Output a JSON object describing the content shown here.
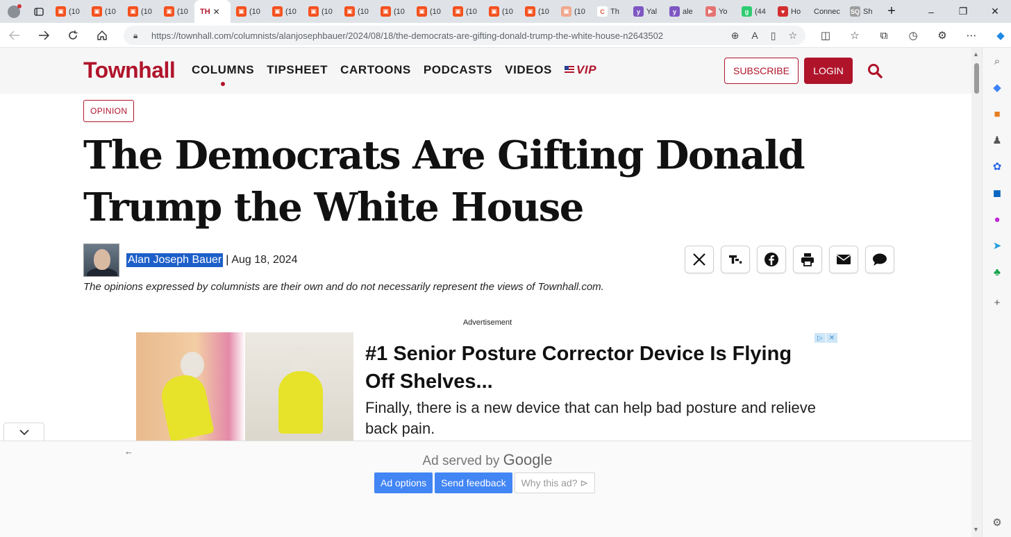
{
  "browser": {
    "tabs": [
      {
        "label": "(10",
        "fav": "#f4511e",
        "glyph": "▣"
      },
      {
        "label": "(10",
        "fav": "#f4511e",
        "glyph": "▣"
      },
      {
        "label": "(10",
        "fav": "#f4511e",
        "glyph": "▣"
      },
      {
        "label": "(10",
        "fav": "#f4511e",
        "glyph": "▣"
      },
      {
        "label": "TH",
        "fav": "",
        "glyph": "",
        "active": true
      },
      {
        "label": "(10",
        "fav": "#f4511e",
        "glyph": "▣"
      },
      {
        "label": "(10",
        "fav": "#f4511e",
        "glyph": "▣"
      },
      {
        "label": "(10",
        "fav": "#f4511e",
        "glyph": "▣"
      },
      {
        "label": "(10",
        "fav": "#f4511e",
        "glyph": "▣"
      },
      {
        "label": "(10",
        "fav": "#f4511e",
        "glyph": "▣"
      },
      {
        "label": "(10",
        "fav": "#f4511e",
        "glyph": "▣"
      },
      {
        "label": "(10",
        "fav": "#f4511e",
        "glyph": "▣"
      },
      {
        "label": "(10",
        "fav": "#f4511e",
        "glyph": "▣"
      },
      {
        "label": "(10",
        "fav": "#f4511e",
        "glyph": "▣"
      },
      {
        "label": "(10",
        "fav": "#f0a88e",
        "glyph": "▣"
      },
      {
        "label": "Th",
        "fav": "#ffffff",
        "glyph": "C"
      },
      {
        "label": "Yal",
        "fav": "#7e57c2",
        "glyph": "y"
      },
      {
        "label": "ale",
        "fav": "#7e57c2",
        "glyph": "y"
      },
      {
        "label": "Yo",
        "fav": "#e57373",
        "glyph": "▶"
      },
      {
        "label": "(44",
        "fav": "#2ecc71",
        "glyph": "g"
      },
      {
        "label": "Ho",
        "fav": "#d32f2f",
        "glyph": "♥"
      },
      {
        "label": "Connec",
        "fav": "",
        "glyph": ""
      },
      {
        "label": "Sh",
        "fav": "#9e9e9e",
        "glyph": "SQ"
      }
    ],
    "url_host": "https://townhall.com",
    "url_path": "/columnists/alanjosephbauer/2024/08/18/the-democrats-are-gifting-donald-trump-the-white-house-n2643502"
  },
  "site": {
    "logo": "Townhall",
    "nav": [
      {
        "label": "COLUMNS",
        "active": true
      },
      {
        "label": "TIPSHEET"
      },
      {
        "label": "CARTOONS"
      },
      {
        "label": "PODCASTS"
      },
      {
        "label": "VIDEOS"
      }
    ],
    "vip_label": "VIP",
    "subscribe_label": "SUBSCRIBE",
    "login_label": "LOGIN",
    "brand_color": "#b0142b"
  },
  "article": {
    "tag": "OPINION",
    "headline_line1": "The Democrats Are Gifting Donald",
    "headline_line2": "Trump the White House",
    "author": "Alan Joseph Bauer",
    "separator": "|",
    "date": "Aug 18, 2024",
    "disclaimer": "The opinions expressed by columnists are their own and do not necessarily represent the views of Townhall.com.",
    "share_icons": [
      "x-icon",
      "truth-social-icon",
      "facebook-icon",
      "print-icon",
      "email-icon",
      "comment-icon"
    ]
  },
  "ad": {
    "label": "Advertisement",
    "title": "#1 Senior Posture Corrector Device Is Flying Off Shelves...",
    "description": "Finally, there is a new device that can help bad posture and relieve back pain.",
    "served_by": "Ad served by",
    "google": "Google",
    "options_label": "Ad options",
    "feedback_label": "Send feedback",
    "why_label": "Why this ad? ⊳"
  }
}
